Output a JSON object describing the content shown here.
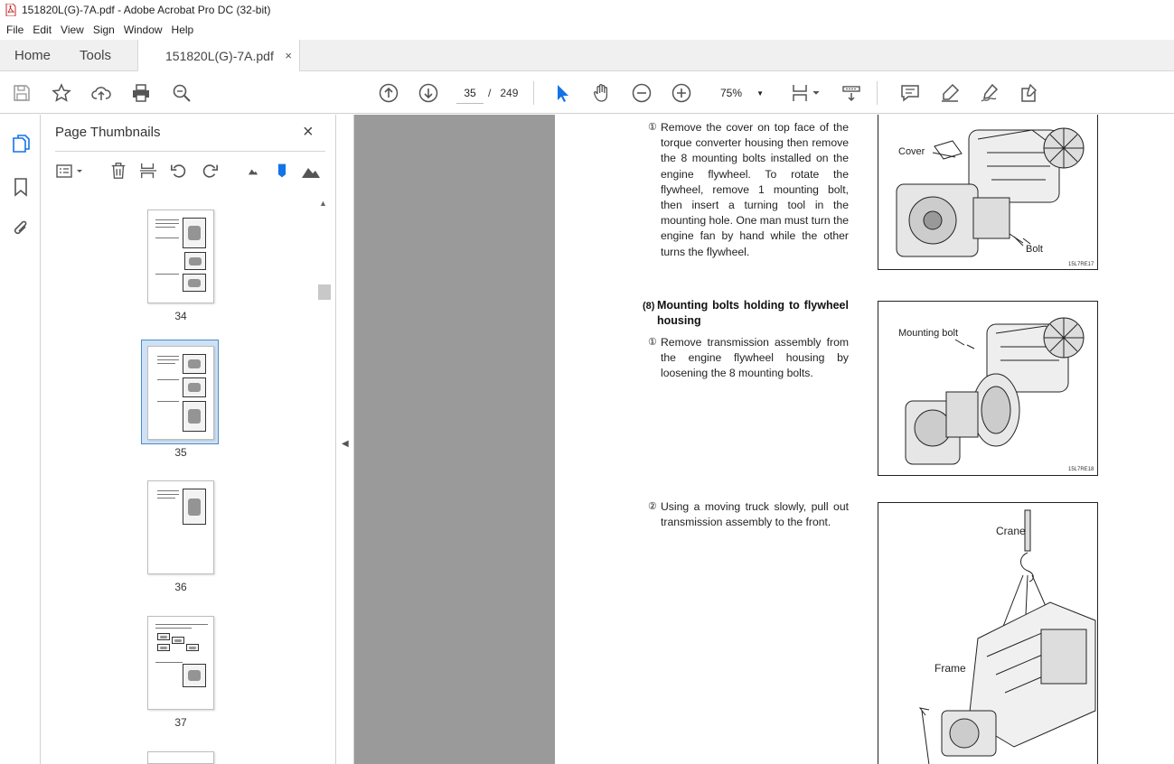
{
  "window": {
    "title": "151820L(G)-7A.pdf - Adobe Acrobat Pro DC (32-bit)"
  },
  "menu": {
    "items": [
      "File",
      "Edit",
      "View",
      "Sign",
      "Window",
      "Help"
    ]
  },
  "tabs": {
    "home": "Home",
    "tools": "Tools",
    "doc": "151820L(G)-7A.pdf",
    "close": "×"
  },
  "toolbar": {
    "page_current": "35",
    "page_sep": "/",
    "page_total": "249",
    "zoom": "75%"
  },
  "panel": {
    "title": "Page Thumbnails",
    "close": "×",
    "thumbnails": [
      {
        "label": "34",
        "selected": false
      },
      {
        "label": "35",
        "selected": true
      },
      {
        "label": "36",
        "selected": false
      },
      {
        "label": "37",
        "selected": false
      }
    ]
  },
  "document": {
    "step1": {
      "num": "①",
      "text": "Remove the cover on top face of the torque converter housing then remove the 8 mounting bolts installed on the engine flywheel.  To rotate the flywheel, remove 1 mounting bolt, then insert a turning tool in the mounting hole.  One man must turn the engine fan by hand while the other turns the flywheel."
    },
    "fig1": {
      "label_cover": "Cover",
      "label_bolt": "Bolt",
      "code": "15L7RE17"
    },
    "section8": {
      "num": "(8)",
      "title": "Mounting bolts holding to flywheel housing"
    },
    "step8_1": {
      "num": "①",
      "text": "Remove transmission assembly from the engine flywheel housing by loosening the 8 mounting bolts."
    },
    "fig2": {
      "label_bolt": "Mounting bolt",
      "code": "15L7RE18"
    },
    "step8_2": {
      "num": "②",
      "text": "Using a moving truck slowly, pull out transmission assembly to the front."
    },
    "fig3": {
      "label_crane": "Crane",
      "label_frame": "Frame"
    }
  },
  "colors": {
    "accent": "#1473e6",
    "doc_bg": "#9a9a9a",
    "selection": "#cfe2f5"
  }
}
